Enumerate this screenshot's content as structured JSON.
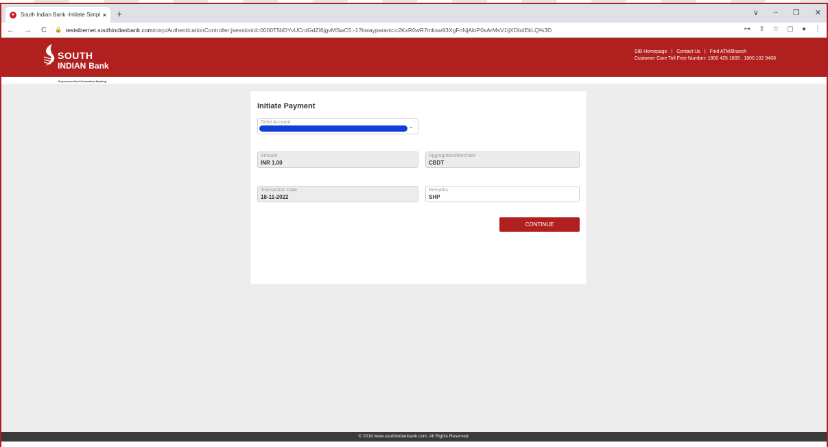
{
  "browser": {
    "tab_title": "South Indian Bank -Initiate Simpl",
    "tab_close": "×",
    "new_tab": "+",
    "url_host": "testsibernet.southindianbank.com",
    "url_path": "/corp/AuthenticationController;jsessionid=0000T5bDYvUCrdGdZI6jgvMSwC5:-1?bwayparam=c2KxR0wR7mksw93XgFnNjAloP0sArMsV1ljXDb4EkLQ%3D",
    "nav_back": "←",
    "nav_forward": "→",
    "nav_reload": "C",
    "window_controls": [
      "∨",
      "–",
      "❐",
      "✕"
    ],
    "right_icons": [
      "⊶",
      "⇪",
      "☆",
      "▢",
      "●",
      "⋮"
    ]
  },
  "bank": {
    "logo_line1": "SOUTH",
    "logo_line2": "INDIAN",
    "logo_line2b": "Bank",
    "tagline": "Experience Next Generation Banking",
    "links": [
      "SIB Homepage",
      "Contact Us",
      "Find ATM/Branch"
    ],
    "separator": "|",
    "customer_care": "Customer Care Toll Free Number: 1800 425 1809 , 1800 102 9408",
    "brand_color": "#b0201f"
  },
  "form": {
    "title": "Initiate Payment",
    "debit_account_label": "Debit Account",
    "amount_label": "Amount",
    "amount_value": "INR 1.00",
    "merchant_label": "Aggregrator/Merchant",
    "merchant_value": "CBDT",
    "date_label": "Transaction Date",
    "date_value": "18-11-2022",
    "remarks_label": "Remarks",
    "remarks_value": "SHP",
    "continue_label": "CONTINUE"
  },
  "footer": {
    "text": "© 2018 www.southindianbank.com. All Rights Reserved."
  }
}
